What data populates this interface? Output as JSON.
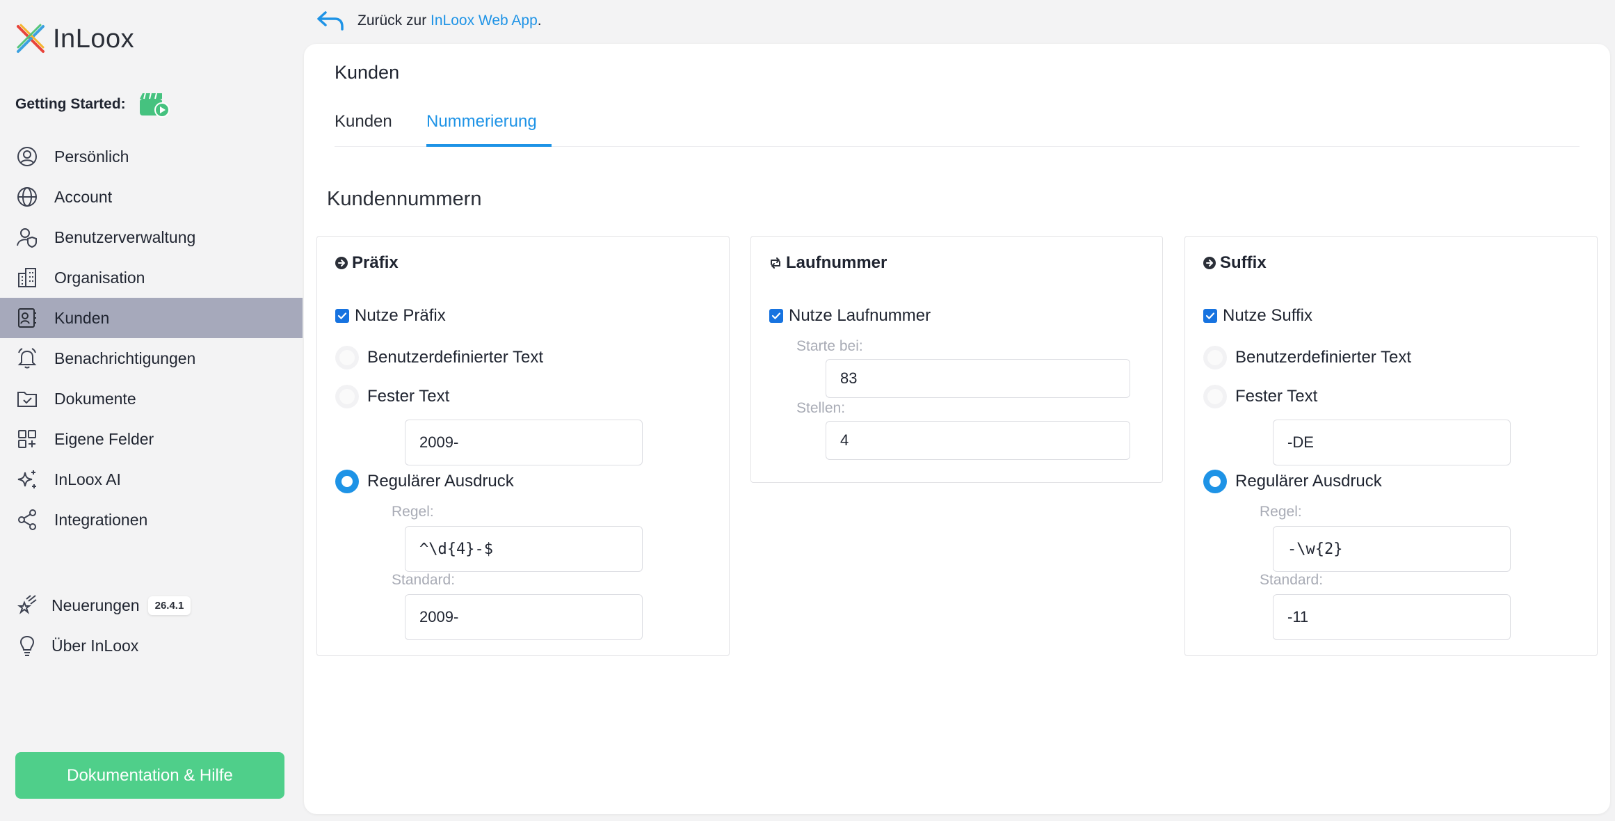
{
  "app": {
    "brand": "InLoox"
  },
  "sidebar": {
    "getting_started": "Getting Started:",
    "items": [
      {
        "label": "Persönlich",
        "icon": "user-circle-icon"
      },
      {
        "label": "Account",
        "icon": "globe-icon"
      },
      {
        "label": "Benutzerverwaltung",
        "icon": "user-shield-icon"
      },
      {
        "label": "Organisation",
        "icon": "building-icon"
      },
      {
        "label": "Kunden",
        "icon": "contact-card-icon",
        "active": true
      },
      {
        "label": "Benachrichtigungen",
        "icon": "bell-icon"
      },
      {
        "label": "Dokumente",
        "icon": "folder-check-icon"
      },
      {
        "label": "Eigene Felder",
        "icon": "grid-plus-icon"
      },
      {
        "label": "InLoox AI",
        "icon": "sparkles-icon"
      },
      {
        "label": "Integrationen",
        "icon": "share-nodes-icon"
      }
    ],
    "bottom_items": [
      {
        "label": "Neuerungen",
        "icon": "shooting-star-icon",
        "badge": "26.4.1"
      },
      {
        "label": "Über InLoox",
        "icon": "lightbulb-icon"
      }
    ],
    "help_button": "Dokumentation & Hilfe"
  },
  "topbar": {
    "back_prefix": "Zurück zur ",
    "back_link": "InLoox Web App",
    "back_suffix": "."
  },
  "page": {
    "title": "Kunden",
    "tabs": [
      {
        "label": "Kunden",
        "active": false
      },
      {
        "label": "Nummerierung",
        "active": true
      }
    ],
    "section_title": "Kundennummern"
  },
  "prefix": {
    "title": "Präfix",
    "use_label": "Nutze Präfix",
    "use_checked": true,
    "option_custom": "Benutzerdefinierter Text",
    "option_fixed": "Fester Text",
    "fixed_value": "2009-",
    "option_regex": "Regulärer Ausdruck",
    "selected": "regex",
    "rule_label": "Regel:",
    "rule_value": "^\\d{4}-$",
    "default_label": "Standard:",
    "default_value": "2009-"
  },
  "sequence": {
    "title": "Laufnummer",
    "use_label": "Nutze Laufnummer",
    "use_checked": true,
    "start_label": "Starte bei:",
    "start_value": "83",
    "digits_label": "Stellen:",
    "digits_value": "4"
  },
  "suffix": {
    "title": "Suffix",
    "use_label": "Nutze Suffix",
    "use_checked": true,
    "option_custom": "Benutzerdefinierter Text",
    "option_fixed": "Fester Text",
    "fixed_value": "-DE",
    "option_regex": "Regulärer Ausdruck",
    "selected": "regex",
    "rule_label": "Regel:",
    "rule_value": "-\\w{2}",
    "default_label": "Standard:",
    "default_value": "-11"
  },
  "colors": {
    "accent": "#1e93e6",
    "active_nav": "#a6a9bb",
    "help_button": "#4fcf8a",
    "checkbox": "#1773e0"
  }
}
